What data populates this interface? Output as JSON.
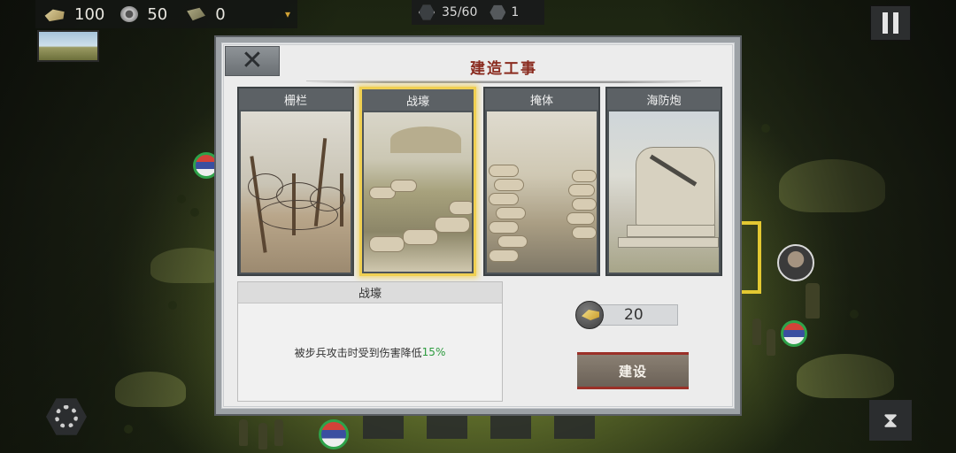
{
  "hud": {
    "resources": [
      {
        "icon": "gold-bars-icon",
        "value": "100"
      },
      {
        "icon": "steel-icon",
        "value": "50"
      },
      {
        "icon": "cards-icon",
        "value": "0"
      }
    ],
    "dropdown_icon": "▾",
    "unit_count": "35/60",
    "flag_count": "1"
  },
  "dialog": {
    "close_glyph": "✕",
    "title": "建造工事",
    "options": [
      {
        "id": "fence",
        "label": "栅栏",
        "selected": false
      },
      {
        "id": "trench",
        "label": "战壕",
        "selected": true
      },
      {
        "id": "bunker",
        "label": "掩体",
        "selected": false
      },
      {
        "id": "coastal-gun",
        "label": "海防炮",
        "selected": false
      }
    ],
    "detail": {
      "name": "战壕",
      "description_prefix": "被步兵攻击时受到伤害降低",
      "description_value": "15%"
    },
    "cost": {
      "icon": "gold-bars-icon",
      "value": "20"
    },
    "build_label": "建设"
  },
  "controls": {
    "hourglass_glyph": "⧗"
  },
  "colors": {
    "title": "#8a2b1f",
    "highlight": "#2d9b3f",
    "selected_border": "#f0d052",
    "build_button_border": "#9b3028"
  }
}
